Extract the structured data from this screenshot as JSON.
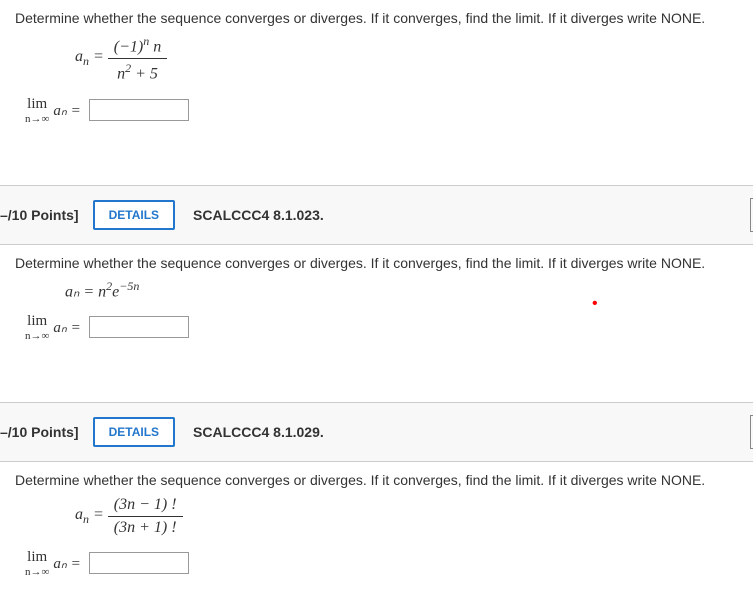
{
  "q1": {
    "instruction": "Determine whether the sequence converges or diverges. If it converges, find the limit. If it diverges write NONE.",
    "a_label": "a",
    "eq": " = ",
    "frac_num_pre": "(−1)",
    "frac_num_sup": "n",
    "frac_num_post": " n",
    "frac_den_pre": "n",
    "frac_den_sup": "2",
    "frac_den_post": " + 5",
    "lim_label": "lim",
    "lim_sub": "n→∞",
    "an_eq": "aₙ = "
  },
  "h2": {
    "points": "–/10 Points]",
    "details": "DETAILS",
    "source": "SCALCCC4 8.1.023."
  },
  "q2": {
    "instruction": "Determine whether the sequence converges or diverges. If it converges, find the limit. If it diverges write NONE.",
    "formula_pre": "aₙ = n",
    "formula_sup1": "2",
    "formula_mid": "e",
    "formula_sup2": "−5n",
    "lim_label": "lim",
    "lim_sub": "n→∞",
    "an_eq": "aₙ = "
  },
  "h3": {
    "points": "–/10 Points]",
    "details": "DETAILS",
    "source": "SCALCCC4 8.1.029."
  },
  "q3": {
    "instruction": "Determine whether the sequence converges or diverges. If it converges, find the limit. If it diverges write NONE.",
    "a_label": "a",
    "eq": " = ",
    "frac_num": "(3n − 1) !",
    "frac_den": "(3n + 1) !",
    "lim_label": "lim",
    "lim_sub": "n→∞",
    "an_eq": "aₙ = "
  }
}
